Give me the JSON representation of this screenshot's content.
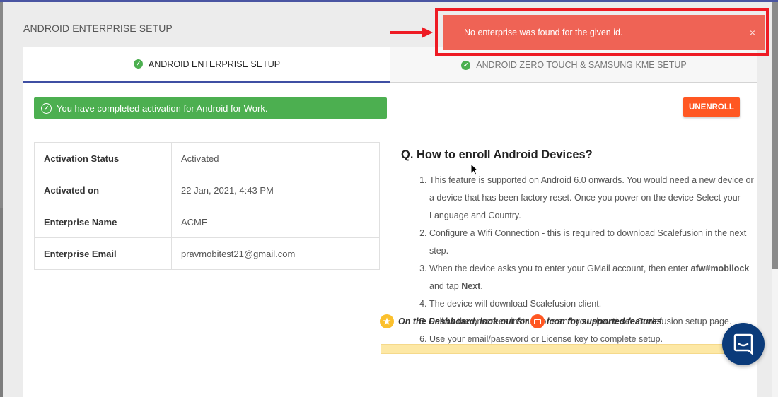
{
  "modal": {
    "title": "ANDROID ENTERPRISE SETUP"
  },
  "tabs": [
    {
      "label": "ANDROID ENTERPRISE SETUP",
      "status": "complete",
      "active": true
    },
    {
      "label": "ANDROID ZERO TOUCH & SAMSUNG KME SETUP",
      "status": "complete",
      "active": false
    }
  ],
  "alert": {
    "text": "You have completed activation for Android for Work.",
    "color": "#4caf50"
  },
  "unenroll_button": {
    "label": "UNENROLL",
    "color": "#ff5722"
  },
  "info_table": [
    {
      "key": "Activation Status",
      "value": "Activated"
    },
    {
      "key": "Activated on",
      "value": "22 Jan, 2021, 4:43 PM"
    },
    {
      "key": "Enterprise Name",
      "value": "ACME"
    },
    {
      "key": "Enterprise Email",
      "value": "pravmobitest21@gmail.com"
    }
  ],
  "faq": {
    "title": "Q. How to enroll Android Devices?",
    "steps": [
      "This feature is supported on Android 6.0 onwards. You would need a new device or a device that has been factory reset. Once you power on the device Select your Language and Country.",
      "Configure a Wifi Connection - this is required to download Scalefusion in the next step.",
      {
        "pre": "When the device asks you to enter your GMail account, then enter ",
        "bold1": "afw#mobilock",
        "mid": " and tap ",
        "bold2": "Next",
        "post": "."
      },
      "The device will download Scalefusion client.",
      "Follow the onscreen instructions and you should see Scalefusion setup page.",
      "Use your email/password or License key to complete setup."
    ],
    "note_pre": "On the Dashboard, look out for",
    "note_post": "icon for supported features."
  },
  "toast": {
    "message": "No enterprise was found for the given id.",
    "close": "×",
    "color": "#ef6355"
  },
  "icons": [
    "check-circle-icon",
    "star-icon",
    "briefcase-icon",
    "close-icon",
    "chat-icon",
    "arrow-icon",
    "cursor-icon"
  ]
}
